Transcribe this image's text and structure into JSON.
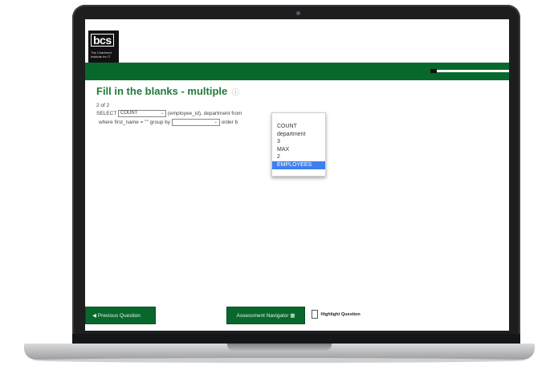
{
  "logo": {
    "mark": "bcs",
    "subtitle": "The Chartered Institute for IT"
  },
  "question": {
    "title": "Fill in the blanks - multiple",
    "info_icon": "info-icon",
    "counter": "2 of 2",
    "line1_prefix": "SELECT",
    "select1_value": "COUNT",
    "line1_suffix": "(employee_id), department from",
    "line2_prefix": "where first_name = \"\" group by",
    "select2_value": "",
    "line2_suffix": "order b"
  },
  "dropdown": {
    "options": [
      "COUNT",
      "department",
      "3",
      "MAX",
      "2",
      "EMPLOYEES"
    ],
    "selected": "EMPLOYEES"
  },
  "footer": {
    "previous_label": "Previous Question",
    "previous_icon": "circle-arrow-left-icon",
    "navigator_label": "Assessment Navigator",
    "navigator_icon": "grid-icon",
    "highlight_label": "Highlight Question",
    "highlight_icon": "document-icon"
  },
  "colors": {
    "brand_green": "#08682c",
    "title_green": "#1f7a3a",
    "selected_option": "#3f7ff0"
  }
}
